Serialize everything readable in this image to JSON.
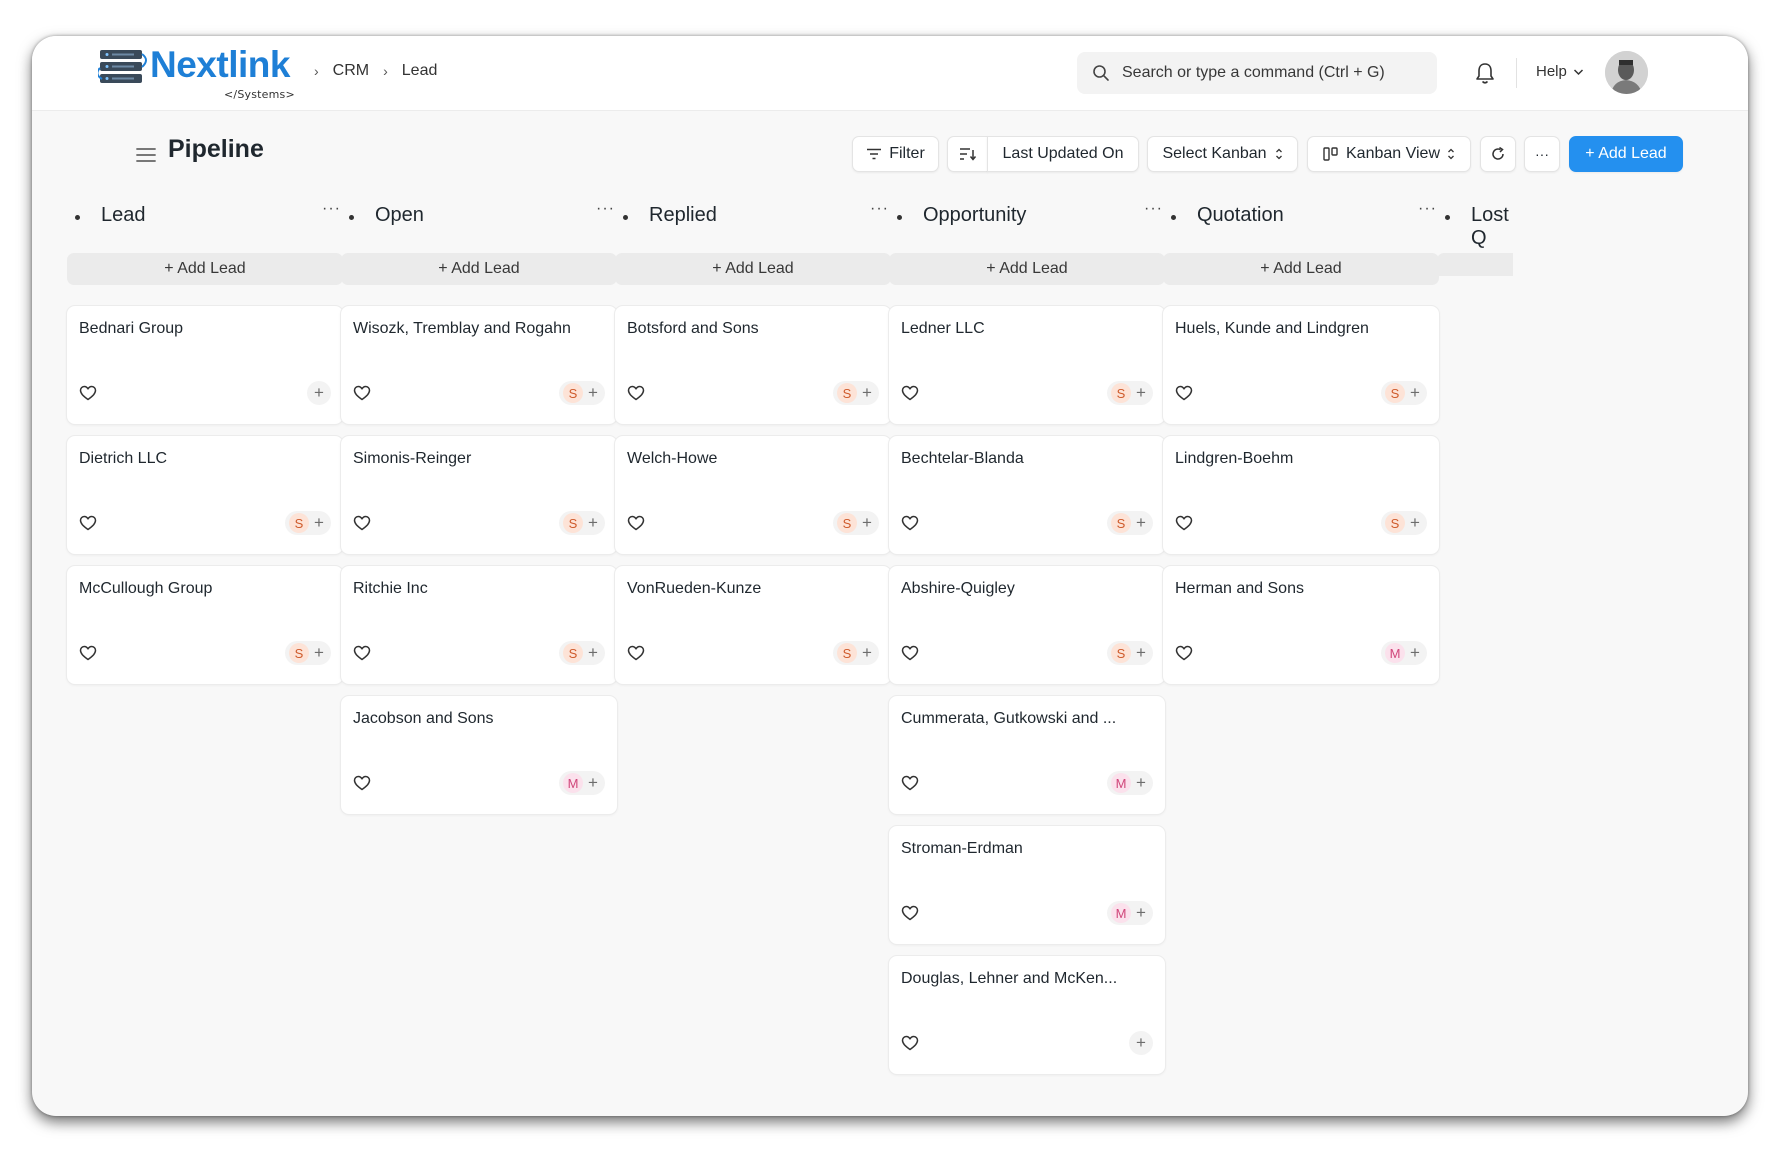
{
  "brand": {
    "name": "Nextlink",
    "tagline": "</Systems>"
  },
  "breadcrumb": [
    "CRM",
    "Lead"
  ],
  "search": {
    "placeholder": "Search or type a command (Ctrl + G)"
  },
  "help_label": "Help",
  "page": {
    "title": "Pipeline"
  },
  "toolbar": {
    "filter_label": "Filter",
    "sort_label": "Last Updated On",
    "select_kanban_label": "Select Kanban",
    "view_label": "Kanban View",
    "more_label": "···",
    "add_lead_label": "+ Add Lead"
  },
  "colors": {
    "primary": "#2490ef",
    "brand": "#1e7fd6",
    "avatar_s": "#cf5b2c",
    "avatar_m": "#d0467a"
  },
  "columns": [
    {
      "title": "Lead",
      "more": "···",
      "add_label": "+ Add Lead",
      "cards": [
        {
          "title": "Bednari Group",
          "assignee": ""
        },
        {
          "title": "Dietrich LLC",
          "assignee": "S"
        },
        {
          "title": "McCullough Group",
          "assignee": "S"
        }
      ]
    },
    {
      "title": "Open",
      "more": "···",
      "add_label": "+ Add Lead",
      "cards": [
        {
          "title": "Wisozk, Tremblay and Rogahn",
          "assignee": "S"
        },
        {
          "title": "Simonis-Reinger",
          "assignee": "S"
        },
        {
          "title": "Ritchie Inc",
          "assignee": "S"
        },
        {
          "title": "Jacobson and Sons",
          "assignee": "M"
        }
      ]
    },
    {
      "title": "Replied",
      "more": "···",
      "add_label": "+ Add Lead",
      "cards": [
        {
          "title": "Botsford and Sons",
          "assignee": "S"
        },
        {
          "title": "Welch-Howe",
          "assignee": "S"
        },
        {
          "title": "VonRueden-Kunze",
          "assignee": "S"
        }
      ]
    },
    {
      "title": "Opportunity",
      "more": "···",
      "add_label": "+ Add Lead",
      "cards": [
        {
          "title": "Ledner LLC",
          "assignee": "S"
        },
        {
          "title": "Bechtelar-Blanda",
          "assignee": "S"
        },
        {
          "title": "Abshire-Quigley",
          "assignee": "S"
        },
        {
          "title": "Cummerata, Gutkowski and ...",
          "assignee": "M"
        },
        {
          "title": "Stroman-Erdman",
          "assignee": "M"
        },
        {
          "title": "Douglas, Lehner and McKen...",
          "assignee": ""
        }
      ]
    },
    {
      "title": "Quotation",
      "more": "···",
      "add_label": "+ Add Lead",
      "cards": [
        {
          "title": "Huels, Kunde and Lindgren",
          "assignee": "S"
        },
        {
          "title": "Lindgren-Boehm",
          "assignee": "S"
        },
        {
          "title": "Herman and Sons",
          "assignee": "M"
        }
      ]
    },
    {
      "title": "Lost Q",
      "more": "",
      "add_label": "",
      "cards": []
    }
  ]
}
